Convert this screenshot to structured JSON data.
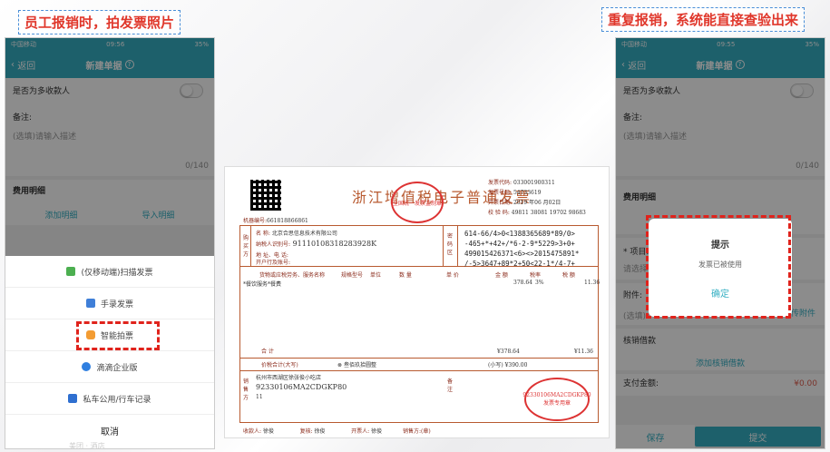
{
  "captions": {
    "left": "员工报销时，拍发票照片",
    "right": "重复报销，系统能直接查验出来"
  },
  "colors": {
    "accent": "#36b0c3",
    "highlight": "#e0231c"
  },
  "left_phone": {
    "status": {
      "carrier": "中国移动",
      "time": "09:56",
      "battery": "35%"
    },
    "nav": {
      "back": "返回",
      "title": "新建单据"
    },
    "multi_payee_label": "是否为多收款人",
    "remark_label": "备注:",
    "remark_placeholder": "(选填)请输入描述",
    "remark_count": "0/140",
    "expense_detail_label": "费用明细",
    "add_detail": "添加明细",
    "import_detail": "导入明细",
    "sheet": {
      "items": [
        {
          "label": "(仅移动端)扫描发票",
          "icon": "scan-icon"
        },
        {
          "label": "手录发票",
          "icon": "manual-invoice-icon"
        },
        {
          "label": "智能拍票",
          "icon": "camera-icon"
        },
        {
          "label": "滴滴企业版",
          "icon": "didi-icon"
        },
        {
          "label": "私车公用/行车记录",
          "icon": "car-icon"
        }
      ],
      "cancel": "取消",
      "faded_hint": "美团 · 酒店"
    }
  },
  "invoice": {
    "title": "浙江增值税电子普通发票",
    "meta": {
      "code_label": "发票代码:",
      "code": "033001900311",
      "number_label": "发票号码:",
      "number": "54733619",
      "date_label": "开票日期:",
      "date": "2019 年06 月02日",
      "check_label": "校 验 码:",
      "check": "49811 38081 19702 98683"
    },
    "machine_label": "机器编号:",
    "machine_no": "661818866861",
    "buyer": {
      "name_label": "名    称:",
      "name": "北京合思信息技术有限公司",
      "tax_label": "纳税人识别号:",
      "tax_id": "91110108318283928K",
      "addr_label": "地 址、电 话:",
      "bank_label": "开户行及账号:"
    },
    "cipher_lines": [
      "614-66/4>0<1388365689*89/0>",
      "-465+*+42+/*6-2-9*5229>3+0+",
      "499015426371<6><>2015475891*",
      "/-5>3647+89*2+50<22-1*/4-7+"
    ],
    "items_header": [
      "货物或应税劳务、服务名称",
      "规格型号",
      "单位",
      "数 量",
      "单 价",
      "金 额",
      "税率",
      "税 额"
    ],
    "item": {
      "name": "*餐饮服务*餐费",
      "amount": "378.64",
      "rate": "3%",
      "tax": "11.36"
    },
    "total_label": "合        计",
    "total_amount": "¥378.64",
    "total_tax": "¥11.36",
    "grand_label": "价税合计(大写)",
    "grand_words": "叁佰玖拾圆整",
    "grand_small": "(小写) ¥390.00",
    "seller": {
      "name": "杭州市西湖区徐张俊小吃店",
      "tax_id": "92330106MA2CDGKP80",
      "addr": "11"
    },
    "footer": {
      "payee_label": "收款人:",
      "payee": "徐俊",
      "review_label": "复核:",
      "review": "徐俊",
      "issuer_label": "开票人:",
      "issuer": "徐俊",
      "seller_label": "销售方:(章)"
    },
    "stamp_text": "全国统一发票监制章",
    "seal_text": "发票专用章",
    "seal_id": "92330106MA2CDGKP80",
    "side_labels": {
      "buyer": "购买方",
      "seller": "销售方",
      "cipher": "密码区",
      "remark": "备注"
    }
  },
  "right_phone": {
    "status": {
      "carrier": "中国移动",
      "time": "09:55",
      "battery": "35%"
    },
    "nav": {
      "back": "返回",
      "title": "新建单据"
    },
    "multi_payee_label": "是否为多收款人",
    "remark_label": "备注:",
    "remark_placeholder": "(选填)请输入描述",
    "remark_count": "0/140",
    "expense_detail_label": "费用明细",
    "project_label": "* 项目:",
    "project_placeholder": "请选择",
    "attachment_label": "附件:",
    "attachment_hint": "(选填)",
    "upload": "上传附件",
    "loan_label": "核销借款",
    "add_loan": "添加核销借款",
    "pay_label": "支付金额:",
    "pay_amount": "¥0.00",
    "dialog": {
      "title": "提示",
      "message": "发票已被使用",
      "confirm": "确定"
    },
    "save": "保存",
    "submit": "提交"
  }
}
